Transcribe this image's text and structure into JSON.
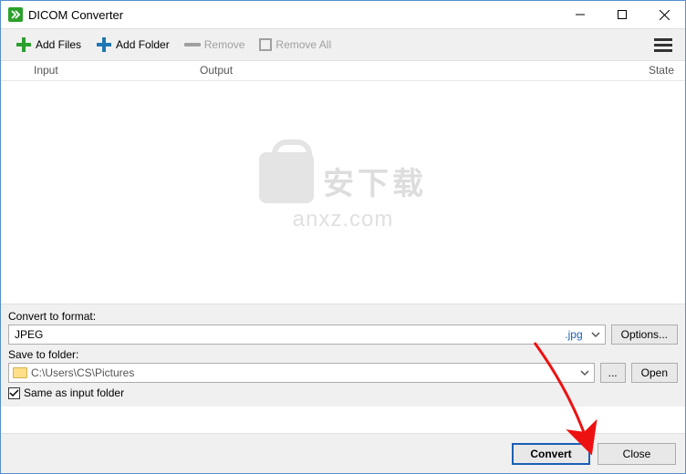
{
  "window": {
    "title": "DICOM Converter"
  },
  "toolbar": {
    "add_files": "Add Files",
    "add_folder": "Add Folder",
    "remove": "Remove",
    "remove_all": "Remove All"
  },
  "columns": {
    "input": "Input",
    "output": "Output",
    "state": "State"
  },
  "watermark": {
    "cjk": "安下载",
    "domain": "anxz.com"
  },
  "format": {
    "label": "Convert to format:",
    "value": "JPEG",
    "ext": ".jpg",
    "options_btn": "Options..."
  },
  "folder": {
    "label": "Save to folder:",
    "path": "C:\\Users\\CS\\Pictures",
    "browse_btn": "...",
    "open_btn": "Open",
    "same_checkbox": "Same as input folder"
  },
  "footer": {
    "convert": "Convert",
    "close": "Close"
  }
}
